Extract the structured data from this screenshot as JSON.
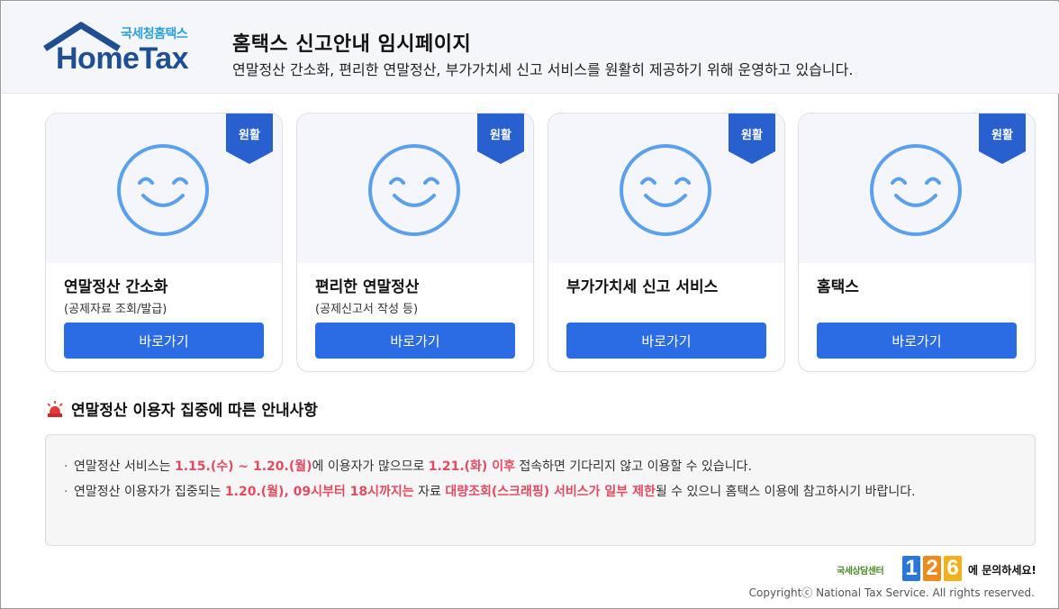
{
  "header": {
    "logo_sub": "국세청홈택스",
    "logo_main": "HomeTax",
    "title": "홈택스 신고안내 임시페이지",
    "subtitle": "연말정산 간소화, 편리한 연말정산, 부가가치세 신고 서비스를 원활히 제공하기 위해 운영하고 있습니다."
  },
  "cards": [
    {
      "badge": "원활",
      "title": "연말정산 간소화",
      "desc": "(공제자료 조회/발급)",
      "button": "바로가기"
    },
    {
      "badge": "원활",
      "title": "편리한 연말정산",
      "desc": "(공제신고서 작성 등)",
      "button": "바로가기"
    },
    {
      "badge": "원활",
      "title": "부가가치세 신고 서비스",
      "desc": "",
      "button": "바로가기"
    },
    {
      "badge": "원활",
      "title": "홈택스",
      "desc": "",
      "button": "바로가기"
    }
  ],
  "notice": {
    "title": "연말정산 이용자 집중에 따른 안내사항",
    "items": [
      {
        "p1": "연말정산 서비스는 ",
        "h1": "1.15.(수) ~ 1.20.(월)",
        "p2": "에 이용자가 많으므로 ",
        "h2": "1.21.(화) 이후",
        "p3": " 접속하면 기다리지 않고 이용할 수 있습니다."
      },
      {
        "p1": "연말정산 이용자가 집중되는 ",
        "h1": "1.20.(월), 09시부터 18시까지는",
        "p2": " 자료 ",
        "h2": "대량조회(스크래핑) 서비스가 일부 제한",
        "p3": "될 수 있으니 홈택스 이용에 참고하시기 바랍니다."
      }
    ]
  },
  "footer": {
    "center_label": "국세상담센터",
    "center_digits": [
      "1",
      "2",
      "6"
    ],
    "center_suffix": "에 문의하세요!",
    "copyright": "Copyrightⓒ National Tax Service. All rights reserved."
  },
  "colors": {
    "accent": "#2b6be3",
    "badge": "#2960cf",
    "highlight": "#e34b63",
    "logo_blue": "#1f4f92",
    "logo_light": "#29a0dc",
    "smile": "#5aa0ec"
  }
}
